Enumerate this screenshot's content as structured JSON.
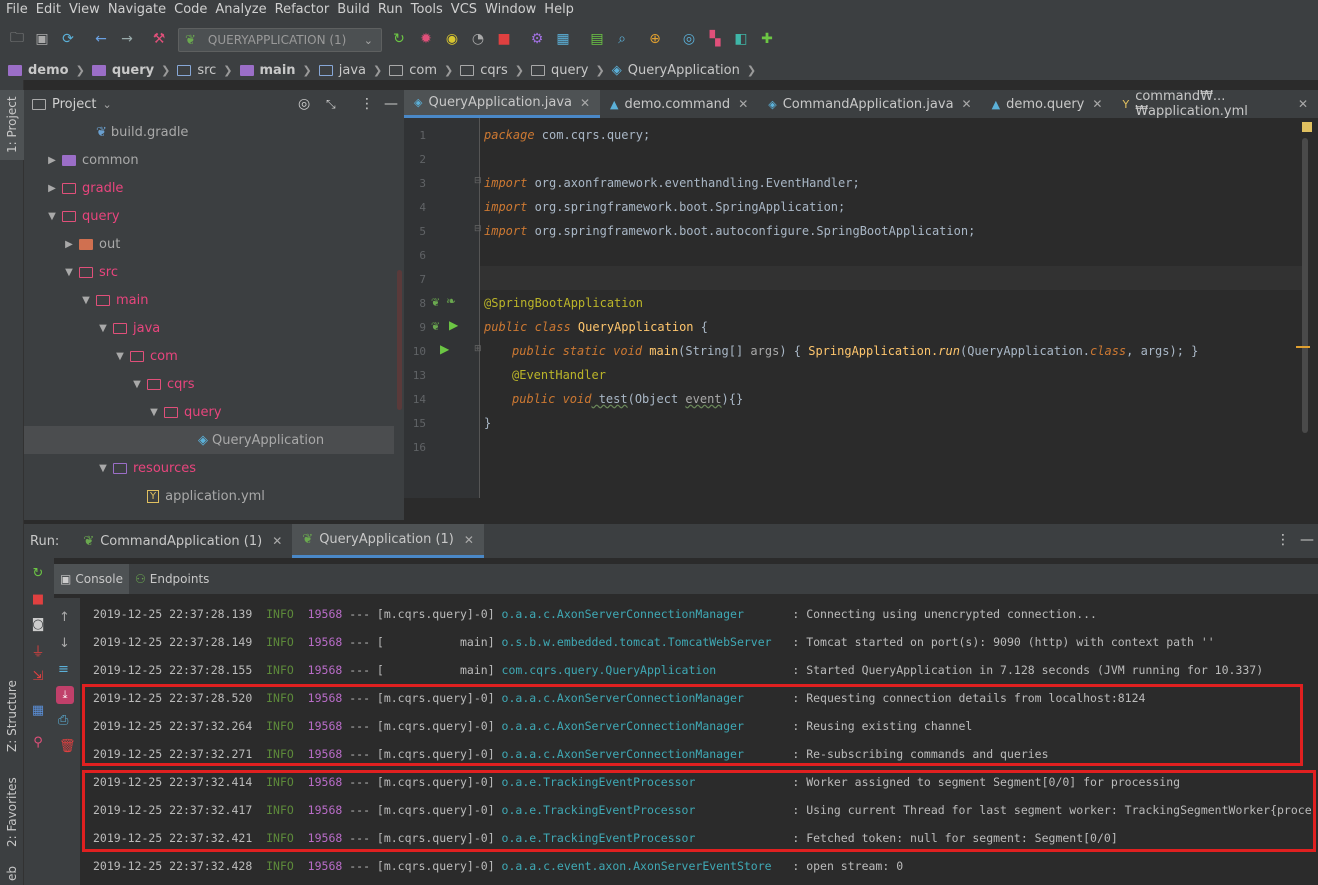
{
  "menu": [
    "File",
    "Edit",
    "View",
    "Navigate",
    "Code",
    "Analyze",
    "Refactor",
    "Build",
    "Run",
    "Tools",
    "VCS",
    "Window",
    "Help"
  ],
  "toolbar": {
    "run_config": "QUERYAPPLICATION (1)"
  },
  "breadcrumb": [
    {
      "label": "demo",
      "bold": true
    },
    {
      "label": "query",
      "bold": true
    },
    {
      "label": "src",
      "bold": false
    },
    {
      "label": "main",
      "bold": true
    },
    {
      "label": "java",
      "bold": false
    },
    {
      "label": "com",
      "bold": false
    },
    {
      "label": "cqrs",
      "bold": false
    },
    {
      "label": "query",
      "bold": false
    },
    {
      "label": "QueryApplication",
      "bold": false
    }
  ],
  "left_stripe": {
    "project": "1: Project",
    "structure": "Z: Structure",
    "favorites": "2: Favorites",
    "web": "eb"
  },
  "project": {
    "title": "Project",
    "tree": [
      {
        "label": "build.gradle",
        "indent": 3,
        "arrow": "",
        "color": "muted"
      },
      {
        "label": "common",
        "indent": 1,
        "arrow": "▶",
        "color": "muted"
      },
      {
        "label": "gradle",
        "indent": 1,
        "arrow": "▶",
        "color": "pink"
      },
      {
        "label": "query",
        "indent": 1,
        "arrow": "▼",
        "color": "pink"
      },
      {
        "label": "out",
        "indent": 2,
        "arrow": "▶",
        "color": "muted"
      },
      {
        "label": "src",
        "indent": 2,
        "arrow": "▼",
        "color": "pink"
      },
      {
        "label": "main",
        "indent": 3,
        "arrow": "▼",
        "color": "pink"
      },
      {
        "label": "java",
        "indent": 4,
        "arrow": "▼",
        "color": "pink"
      },
      {
        "label": "com",
        "indent": 5,
        "arrow": "▼",
        "color": "pink"
      },
      {
        "label": "cqrs",
        "indent": 6,
        "arrow": "▼",
        "color": "pink"
      },
      {
        "label": "query",
        "indent": 7,
        "arrow": "▼",
        "color": "pink"
      },
      {
        "label": "QueryApplication",
        "indent": 9,
        "arrow": "",
        "color": "muted"
      },
      {
        "label": "resources",
        "indent": 4,
        "arrow": "▼",
        "color": "pink"
      },
      {
        "label": "application.yml",
        "indent": 6,
        "arrow": "",
        "color": "muted"
      }
    ]
  },
  "editor": {
    "tabs": [
      "QueryApplication.java",
      "demo.command",
      "CommandApplication.java",
      "demo.query",
      "command₩...₩application.yml"
    ],
    "line_numbers": [
      "1",
      "2",
      "3",
      "4",
      "5",
      "6",
      "7",
      "8",
      "9",
      "10",
      "13",
      "14",
      "15",
      "16"
    ],
    "code": {
      "l1_kw": "package",
      "l1_rest": " com.cqrs.query;",
      "l3_kw": "import",
      "l3_a": " org.axonframework.eventhandling.",
      "l3_b": "EventHandler",
      "l4_kw": "import",
      "l4_a": " org.springframework.boot.",
      "l4_b": "SpringApplication",
      "l5_kw": "import",
      "l5_a": " org.springframework.boot.autoconfigure.",
      "l5_b": "SpringBootApplication",
      "l8": "@SpringBootApplication",
      "l9_kw": "public class",
      "l9_name": " QueryApplication ",
      "l9_brace": "{",
      "l10_kw": "public static void",
      "l10_m": " main",
      "l10_a": "(String[] ",
      "l10_args": "args",
      "l10_b": ") { ",
      "l10_sa": "SpringApplication.",
      "l10_run": "run",
      "l10_c": "(QueryApplication.",
      "l10_cls": "class",
      ", ": "",
      "l10_d": ", args); }",
      "l13": "@EventHandler",
      "l14_kw": "public void",
      "l14_m": " test",
      "l14_a": "(Object ",
      "l14_ev": "event",
      "l14_b": "){}",
      "l15": "}"
    }
  },
  "run": {
    "label": "Run:",
    "tabs": [
      "CommandApplication (1)",
      "QueryApplication (1)"
    ],
    "subtabs": [
      "Console",
      "Endpoints"
    ],
    "logs": [
      {
        "ts": "2019-12-25 22:37:28.139",
        "lv": "INFO",
        "pid": "19568",
        "th": " --- [m.cqrs.query]-0] ",
        "lg": "o.a.a.c.AxonServerConnectionManager      ",
        "msg": " : Connecting using unencrypted connection..."
      },
      {
        "ts": "2019-12-25 22:37:28.149",
        "lv": "INFO",
        "pid": "19568",
        "th": " --- [           main] ",
        "lg": "o.s.b.w.embedded.tomcat.TomcatWebServer  ",
        "msg": " : Tomcat started on port(s): 9090 (http) with context path ''"
      },
      {
        "ts": "2019-12-25 22:37:28.155",
        "lv": "INFO",
        "pid": "19568",
        "th": " --- [           main] ",
        "lg": "com.cqrs.query.QueryApplication          ",
        "msg": " : Started QueryApplication in 7.128 seconds (JVM running for 10.337)"
      },
      {
        "ts": "2019-12-25 22:37:28.520",
        "lv": "INFO",
        "pid": "19568",
        "th": " --- [m.cqrs.query]-0] ",
        "lg": "o.a.a.c.AxonServerConnectionManager      ",
        "msg": " : Requesting connection details from localhost:8124"
      },
      {
        "ts": "2019-12-25 22:37:32.264",
        "lv": "INFO",
        "pid": "19568",
        "th": " --- [m.cqrs.query]-0] ",
        "lg": "o.a.a.c.AxonServerConnectionManager      ",
        "msg": " : Reusing existing channel"
      },
      {
        "ts": "2019-12-25 22:37:32.271",
        "lv": "INFO",
        "pid": "19568",
        "th": " --- [m.cqrs.query]-0] ",
        "lg": "o.a.a.c.AxonServerConnectionManager      ",
        "msg": " : Re-subscribing commands and queries"
      },
      {
        "ts": "2019-12-25 22:37:32.414",
        "lv": "INFO",
        "pid": "19568",
        "th": " --- [m.cqrs.query]-0] ",
        "lg": "o.a.e.TrackingEventProcessor             ",
        "msg": " : Worker assigned to segment Segment[0/0] for processing"
      },
      {
        "ts": "2019-12-25 22:37:32.417",
        "lv": "INFO",
        "pid": "19568",
        "th": " --- [m.cqrs.query]-0] ",
        "lg": "o.a.e.TrackingEventProcessor             ",
        "msg": " : Using current Thread for last segment worker: TrackingSegmentWorker{proce"
      },
      {
        "ts": "2019-12-25 22:37:32.421",
        "lv": "INFO",
        "pid": "19568",
        "th": " --- [m.cqrs.query]-0] ",
        "lg": "o.a.e.TrackingEventProcessor             ",
        "msg": " : Fetched token: null for segment: Segment[0/0]"
      },
      {
        "ts": "2019-12-25 22:37:32.428",
        "lv": "INFO",
        "pid": "19568",
        "th": " --- [m.cqrs.query]-0] ",
        "lg": "o.a.a.c.event.axon.AxonServerEventStore  ",
        "msg": " : open stream: 0"
      }
    ]
  },
  "colors": {
    "highlight_box": "#e02020",
    "accent": "#4a88c7"
  }
}
